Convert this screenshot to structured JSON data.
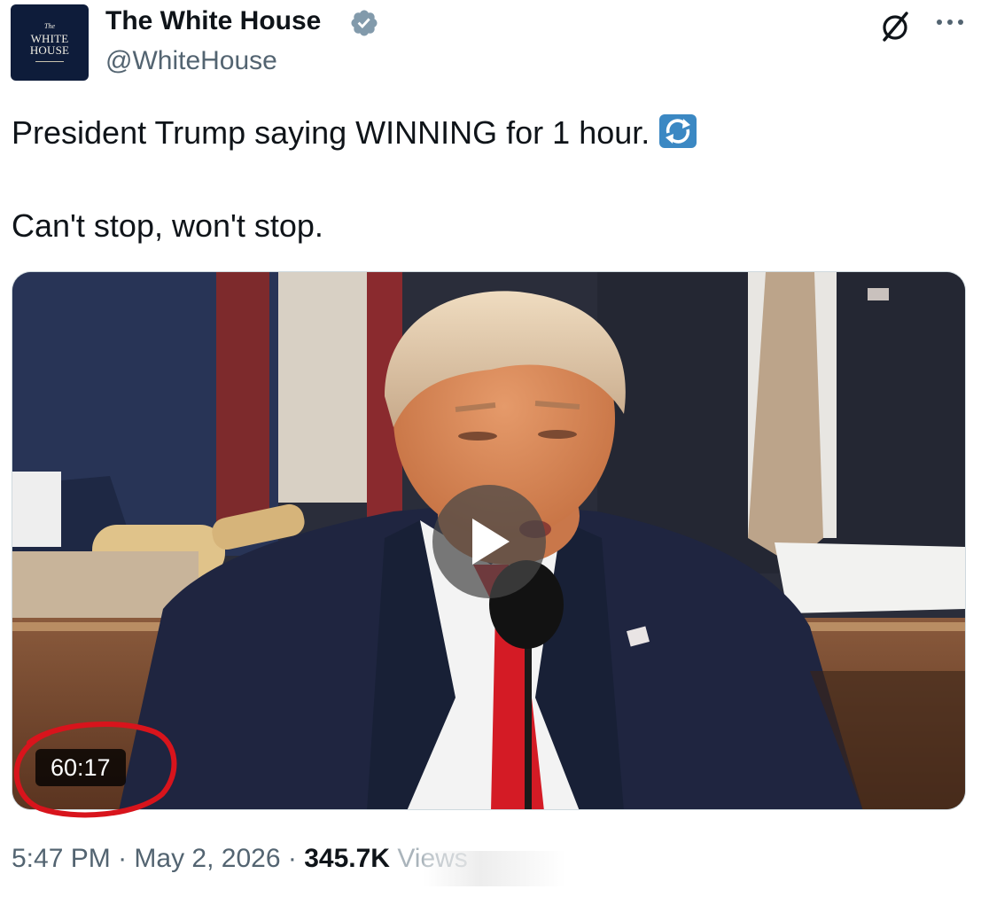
{
  "account": {
    "avatar_lines": [
      "The",
      "WHITE",
      "HOUSE"
    ],
    "name": "The White House",
    "handle": "@WhiteHouse",
    "verified": true
  },
  "post": {
    "line1": "President Trump saying WINNING for 1 hour.",
    "line1_emoji": "repeat-button-emoji",
    "line2": "Can't stop, won't stop."
  },
  "video": {
    "duration": "60:17",
    "play_icon": "play-icon"
  },
  "footer": {
    "time": "5:47 PM",
    "separator": "·",
    "date": "May 2, 2026",
    "views_count": "345.7K",
    "views_label": "Views"
  },
  "icons": {
    "grok": "grok-icon",
    "more": "more-icon"
  },
  "colors": {
    "verified_badge": "#829aab",
    "annotation_circle": "#d8141c",
    "secondary_text": "#536471",
    "emoji_bg": "#3b88c3"
  }
}
